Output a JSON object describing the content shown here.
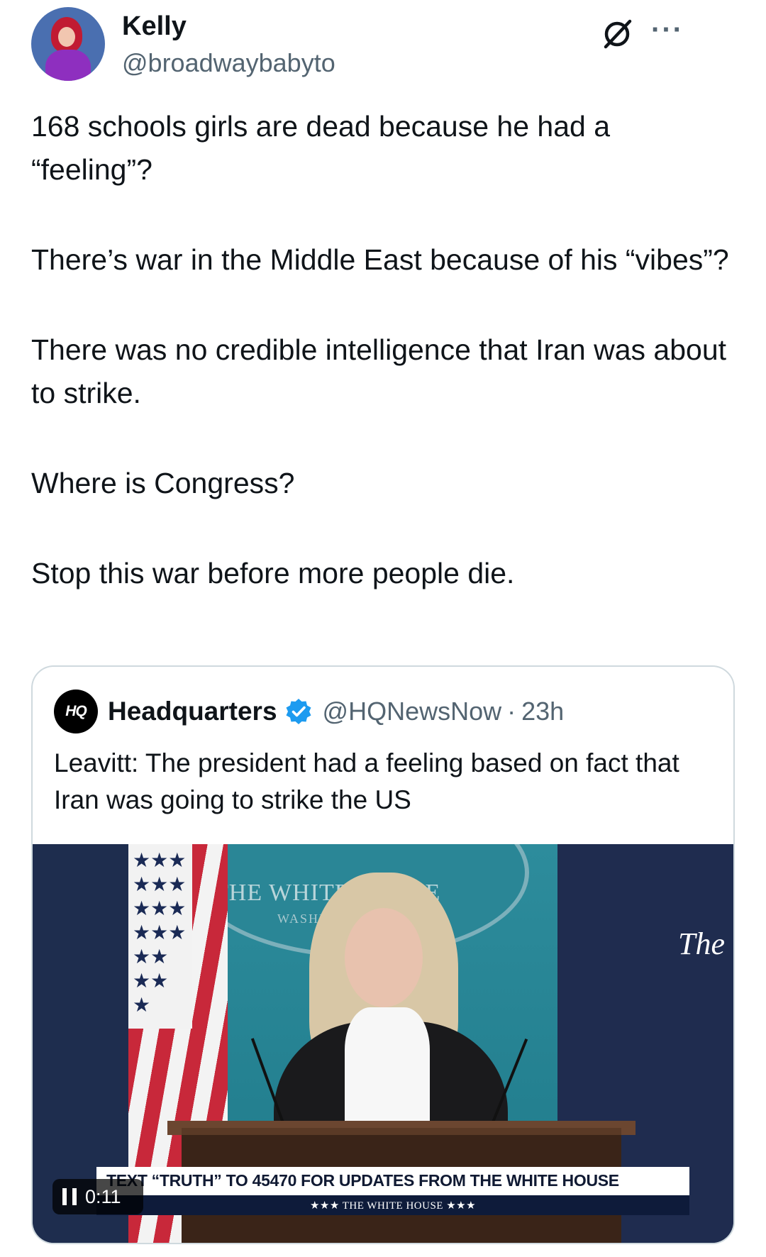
{
  "author": {
    "name": "Kelly",
    "handle": "@broadwaybabyto",
    "avatar_icon": "profile-photo",
    "actions": {
      "grok_icon": "slashed-circle-icon",
      "more_label": "···"
    }
  },
  "tweet": {
    "paragraphs": [
      "168 schools girls are dead because he had a “feeling”?",
      "There’s war in the Middle East because of his “vibes”?",
      "There was no credible intelligence that Iran was about to strike.",
      "Where is Congress?",
      "Stop this war before more people die."
    ]
  },
  "quote": {
    "logo_text": "HQ",
    "name": "Headquarters",
    "verified": true,
    "handle": "@HQNewsNow",
    "separator": "·",
    "time": "23h",
    "text": "Leavitt: The president had a feeling based on fact that Iran was going to strike the US",
    "video": {
      "seal_text": "THE WHITE HOUSE",
      "seal_sub": "WASHINGTON",
      "the_label": "The",
      "chyron_top": "TEXT “TRUTH” TO 45470 FOR UPDATES FROM THE WHITE HOUSE",
      "chyron_bottom": "★★★ THE WHITE HOUSE ★★★",
      "time": "0:11",
      "state": "playing"
    }
  },
  "colors": {
    "text": "#0f1419",
    "secondary": "#536471",
    "border": "#cfd9de",
    "verified": "#1d9bf0"
  }
}
